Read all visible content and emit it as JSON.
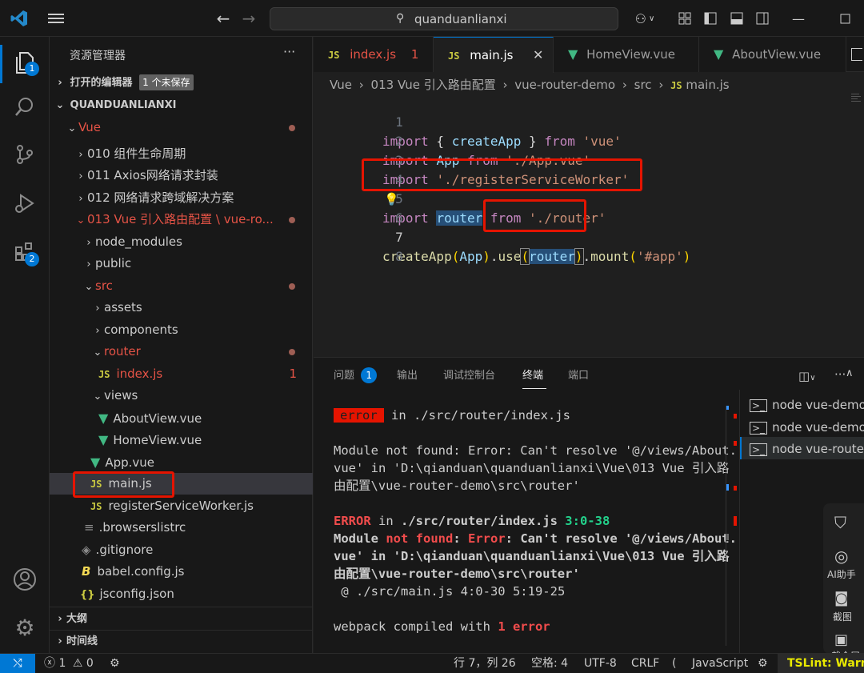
{
  "titlebar": {
    "search_text": "quanduanlianxi"
  },
  "activity": {
    "explorer_badge": "1",
    "extensions_badge": "2"
  },
  "sidebar": {
    "title": "资源管理器",
    "more": "···",
    "open_editors": "打开的编辑器",
    "unsaved_badge": "1 个未保存",
    "root": "QUANDUANLIANXI",
    "items": [
      {
        "label": "Vue"
      },
      {
        "label": "010 组件生命周期"
      },
      {
        "label": "011 Axios网络请求封装"
      },
      {
        "label": "012 网络请求跨域解决方案"
      },
      {
        "label": "013 Vue 引入路由配置 \\ vue-ro..."
      },
      {
        "label": "node_modules"
      },
      {
        "label": "public"
      },
      {
        "label": "src"
      },
      {
        "label": "assets"
      },
      {
        "label": "components"
      },
      {
        "label": "router"
      },
      {
        "label": "index.js",
        "badge": "1"
      },
      {
        "label": "views"
      },
      {
        "label": "AboutView.vue"
      },
      {
        "label": "HomeView.vue"
      },
      {
        "label": "App.vue"
      },
      {
        "label": "main.js"
      },
      {
        "label": "registerServiceWorker.js"
      },
      {
        "label": ".browserslistrc"
      },
      {
        "label": ".gitignore"
      },
      {
        "label": "babel.config.js"
      },
      {
        "label": "jsconfig.json"
      }
    ],
    "outline": "大纲",
    "timeline": "时间线"
  },
  "tabs": [
    {
      "label": "index.js",
      "badge": "1"
    },
    {
      "label": "main.js"
    },
    {
      "label": "HomeView.vue"
    },
    {
      "label": "AboutView.vue"
    }
  ],
  "breadcrumb": [
    "Vue",
    "013 Vue 引入路由配置",
    "vue-router-demo",
    "src",
    "main.js"
  ],
  "code": {
    "line1": [
      "import",
      " { ",
      "createApp",
      " } ",
      "from",
      " ",
      "'vue'"
    ],
    "line2": [
      "import",
      " ",
      "App",
      " ",
      "from",
      " ",
      "'./App.vue'"
    ],
    "line3": [
      "import",
      " ",
      "'./registerServiceWorker'"
    ],
    "line5": [
      "import",
      " ",
      "router",
      " ",
      "from",
      " ",
      "'./router'"
    ],
    "line7": [
      "createApp",
      "(",
      "App",
      ")",
      ".",
      "use",
      "(",
      "router",
      ")",
      ".",
      "mount",
      "(",
      "'#app'",
      ")"
    ],
    "line_numbers": [
      "1",
      "2",
      "3",
      "4",
      "5",
      "6",
      "7",
      "8"
    ]
  },
  "panel": {
    "tabs": [
      "问题",
      "输出",
      "调试控制台",
      "终端",
      "端口"
    ],
    "problems_badge": "1",
    "terminals": [
      "node  vue-demo",
      "node  vue-demo",
      "node  vue-router-..."
    ],
    "t1_badge": "error",
    "t1_rest": " in ./src/router/index.js",
    "t2": "Module not found: Error: Can't resolve '@/views/About.",
    "t3": "vue' in 'D:\\qianduan\\quanduanlianxi\\Vue\\013 Vue 引入路",
    "t4": "由配置\\vue-router-demo\\src\\router'",
    "t5a": "ERROR",
    "t5b": " in ",
    "t5c": "./src/router/index.js",
    "t5d": " 3:0-38",
    "t6a": "Module ",
    "t6b": "not found",
    "t6c": ": ",
    "t6d": "Error",
    "t6e": ": Can't resolve '@/views/About.",
    "t7": "vue' in 'D:\\qianduan\\quanduanlianxi\\Vue\\013 Vue 引入路",
    "t8": "由配置\\vue-router-demo\\src\\router'",
    "t9": " @ ./src/main.js 4:0-30 5:19-25",
    "t10a": "webpack compiled with ",
    "t10b": "1 error"
  },
  "float_tools": {
    "ai": "AI助手",
    "shot": "截图",
    "full": "截全屏"
  },
  "status": {
    "errors": "1",
    "warnings": "0",
    "position": "行 7，列 26",
    "spaces": "空格: 4",
    "encoding": "UTF-8",
    "eol": "CRLF",
    "language": "JavaScript",
    "tslint": "TSLint: Warning"
  },
  "colors": {
    "accent": "#0078d4",
    "error": "#f14c4c",
    "highlight_box": "#e51400"
  }
}
